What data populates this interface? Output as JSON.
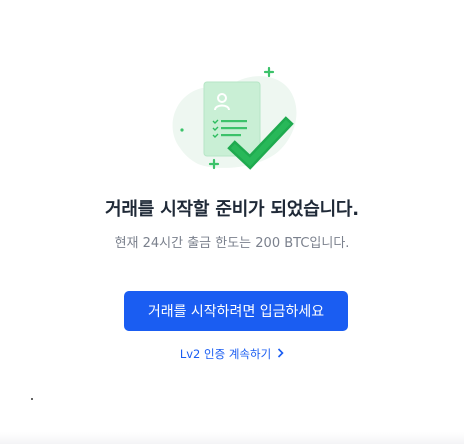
{
  "headline": "거래를 시작할 준비가 되었습니다.",
  "subtext": "현재 24시간 출금 한도는 200 BTC입니다.",
  "cta_button_label": "거래를 시작하려면 입금하세요",
  "verify_link_label": "Lv2 인증 계속하기",
  "colors": {
    "accent": "#1a5df2",
    "illustration_green": "#2dbd5f",
    "headline": "#1f2937",
    "subtext": "#7b818d"
  },
  "icons": {
    "illustration": "verified-document-checkmark-icon",
    "link_chevron": "chevron-right-icon"
  }
}
